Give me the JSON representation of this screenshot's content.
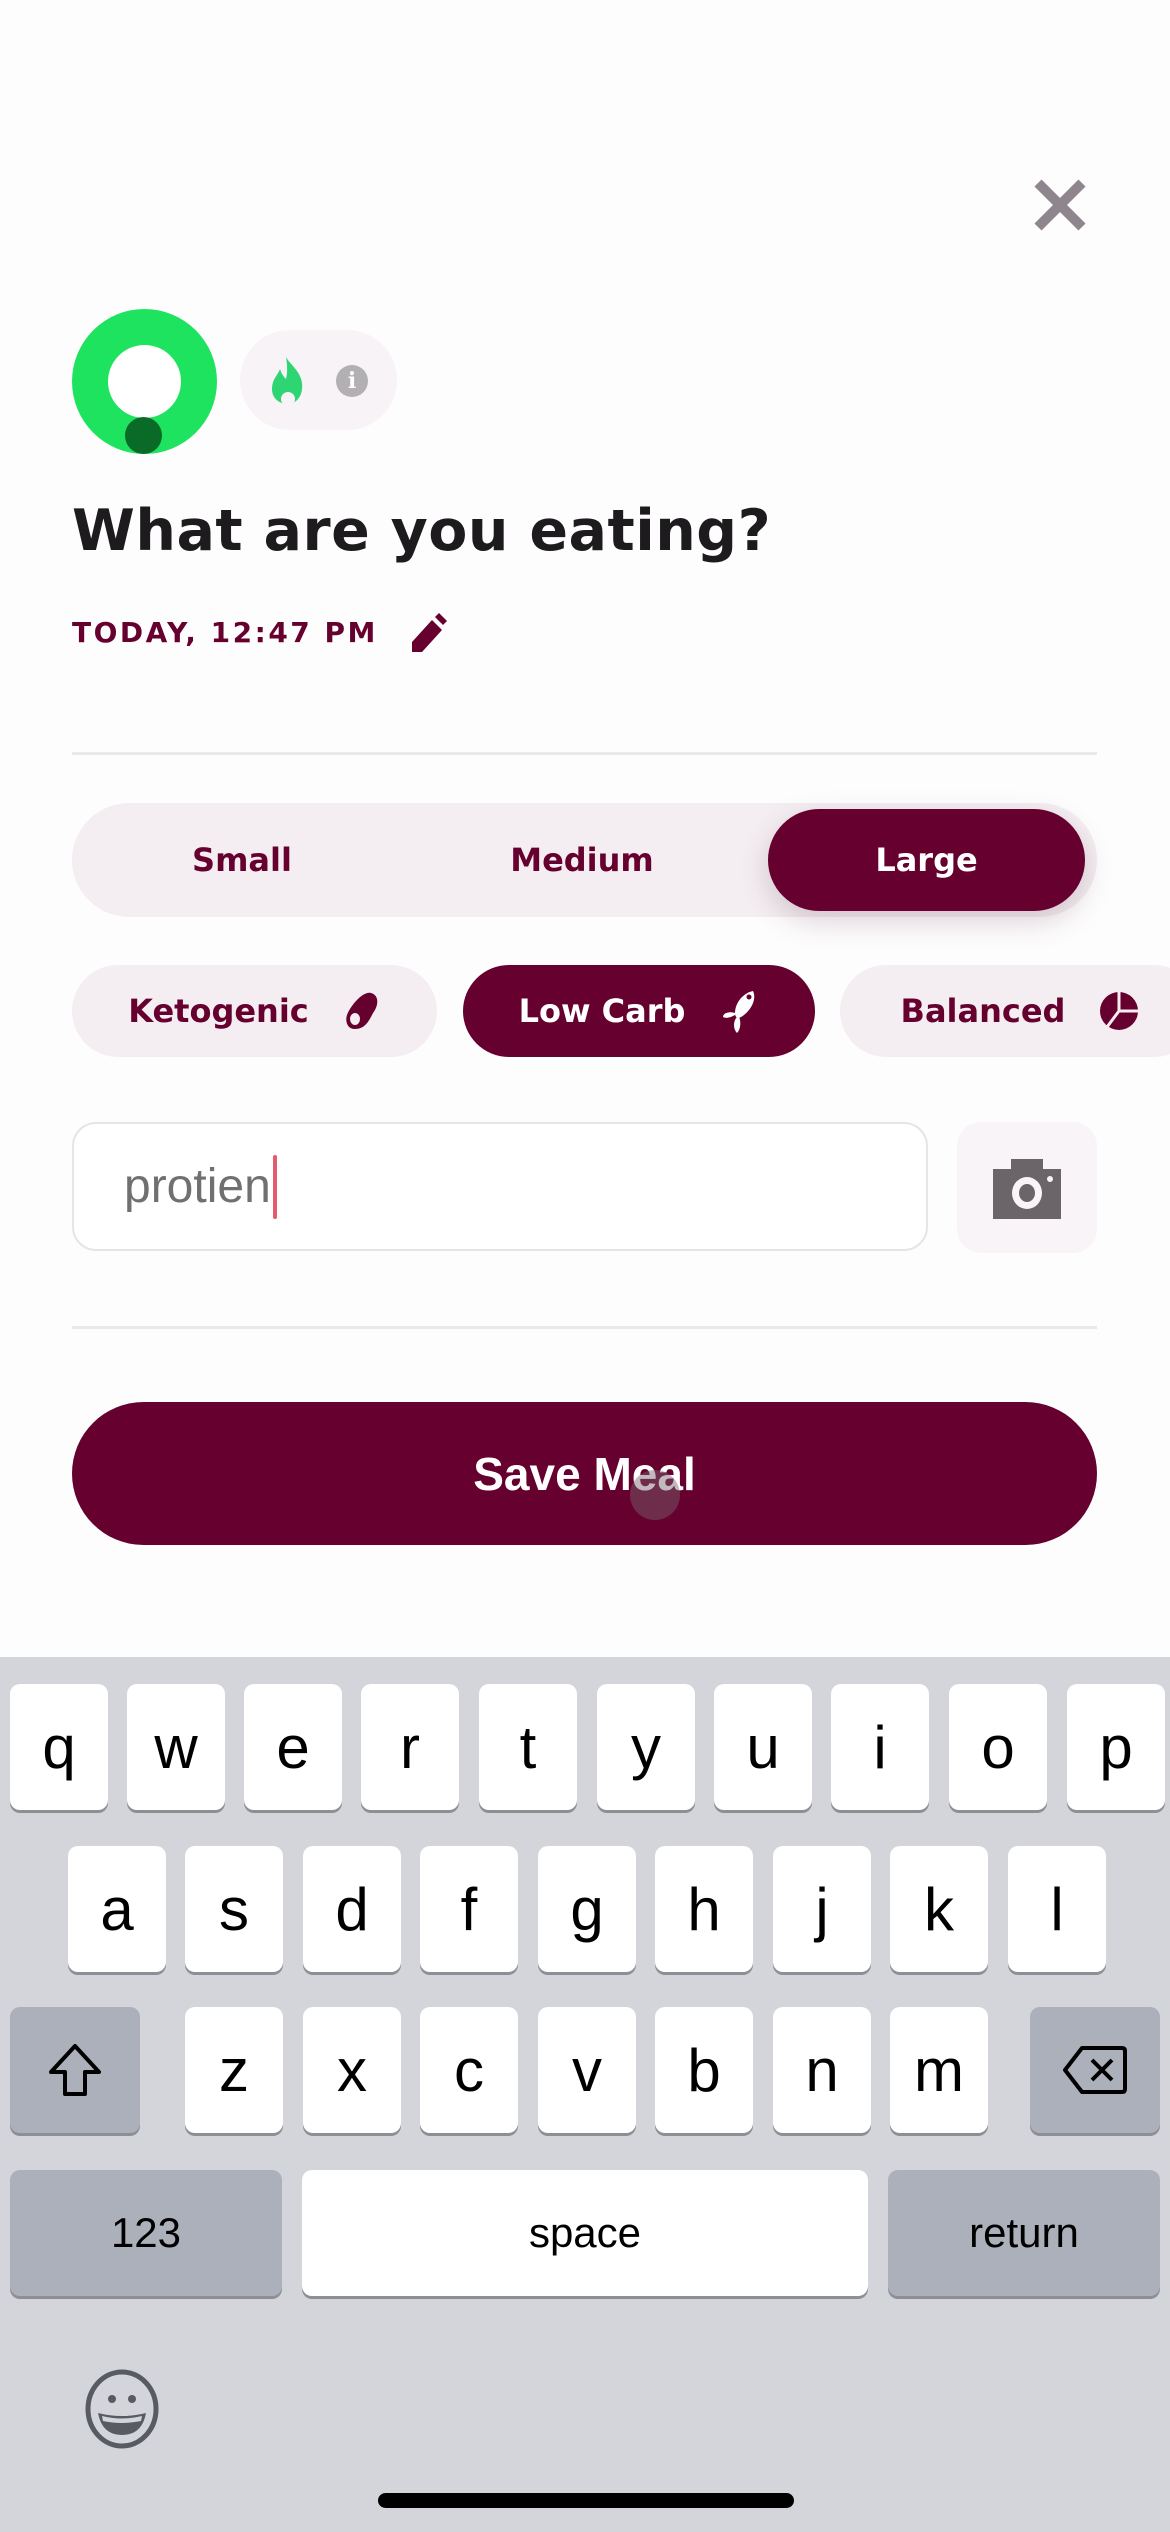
{
  "header": {
    "close_icon": "close-x-icon",
    "status_icons": [
      "activity-ring-icon",
      "flame-icon",
      "info-icon"
    ],
    "info_glyph": "i"
  },
  "title": "What are you eating?",
  "date": {
    "label": "TODAY, 12:47 PM",
    "edit_icon": "pencil-icon"
  },
  "portion": {
    "options": [
      {
        "label": "Small",
        "selected": false
      },
      {
        "label": "Medium",
        "selected": false
      },
      {
        "label": "Large",
        "selected": true
      }
    ]
  },
  "diet": {
    "options": [
      {
        "label": "Ketogenic",
        "icon": "avocado-icon",
        "selected": false
      },
      {
        "label": "Low Carb",
        "icon": "fish-icon",
        "selected": true
      },
      {
        "label": "Balanced",
        "icon": "pie-chart-icon",
        "selected": false
      }
    ]
  },
  "meal_input": {
    "value": "protien",
    "camera_icon": "camera-icon"
  },
  "save_button": "Save Meal",
  "colors": {
    "brand": "#66002f",
    "ring_green": "#1ee35f",
    "ring_dot": "#0a6a28",
    "chip_bg": "#f4eef2",
    "caret": "#e25c6b",
    "keyboard_bg": "#d3d5db"
  },
  "keyboard": {
    "row1": [
      "q",
      "w",
      "e",
      "r",
      "t",
      "y",
      "u",
      "i",
      "o",
      "p"
    ],
    "row2": [
      "a",
      "s",
      "d",
      "f",
      "g",
      "h",
      "j",
      "k",
      "l"
    ],
    "row3": [
      "z",
      "x",
      "c",
      "v",
      "b",
      "n",
      "m"
    ],
    "shift_icon": "shift-arrow-icon",
    "delete_icon": "backspace-icon",
    "numbers_label": "123",
    "space_label": "space",
    "return_label": "return",
    "emoji_icon": "emoji-smiley-icon"
  }
}
